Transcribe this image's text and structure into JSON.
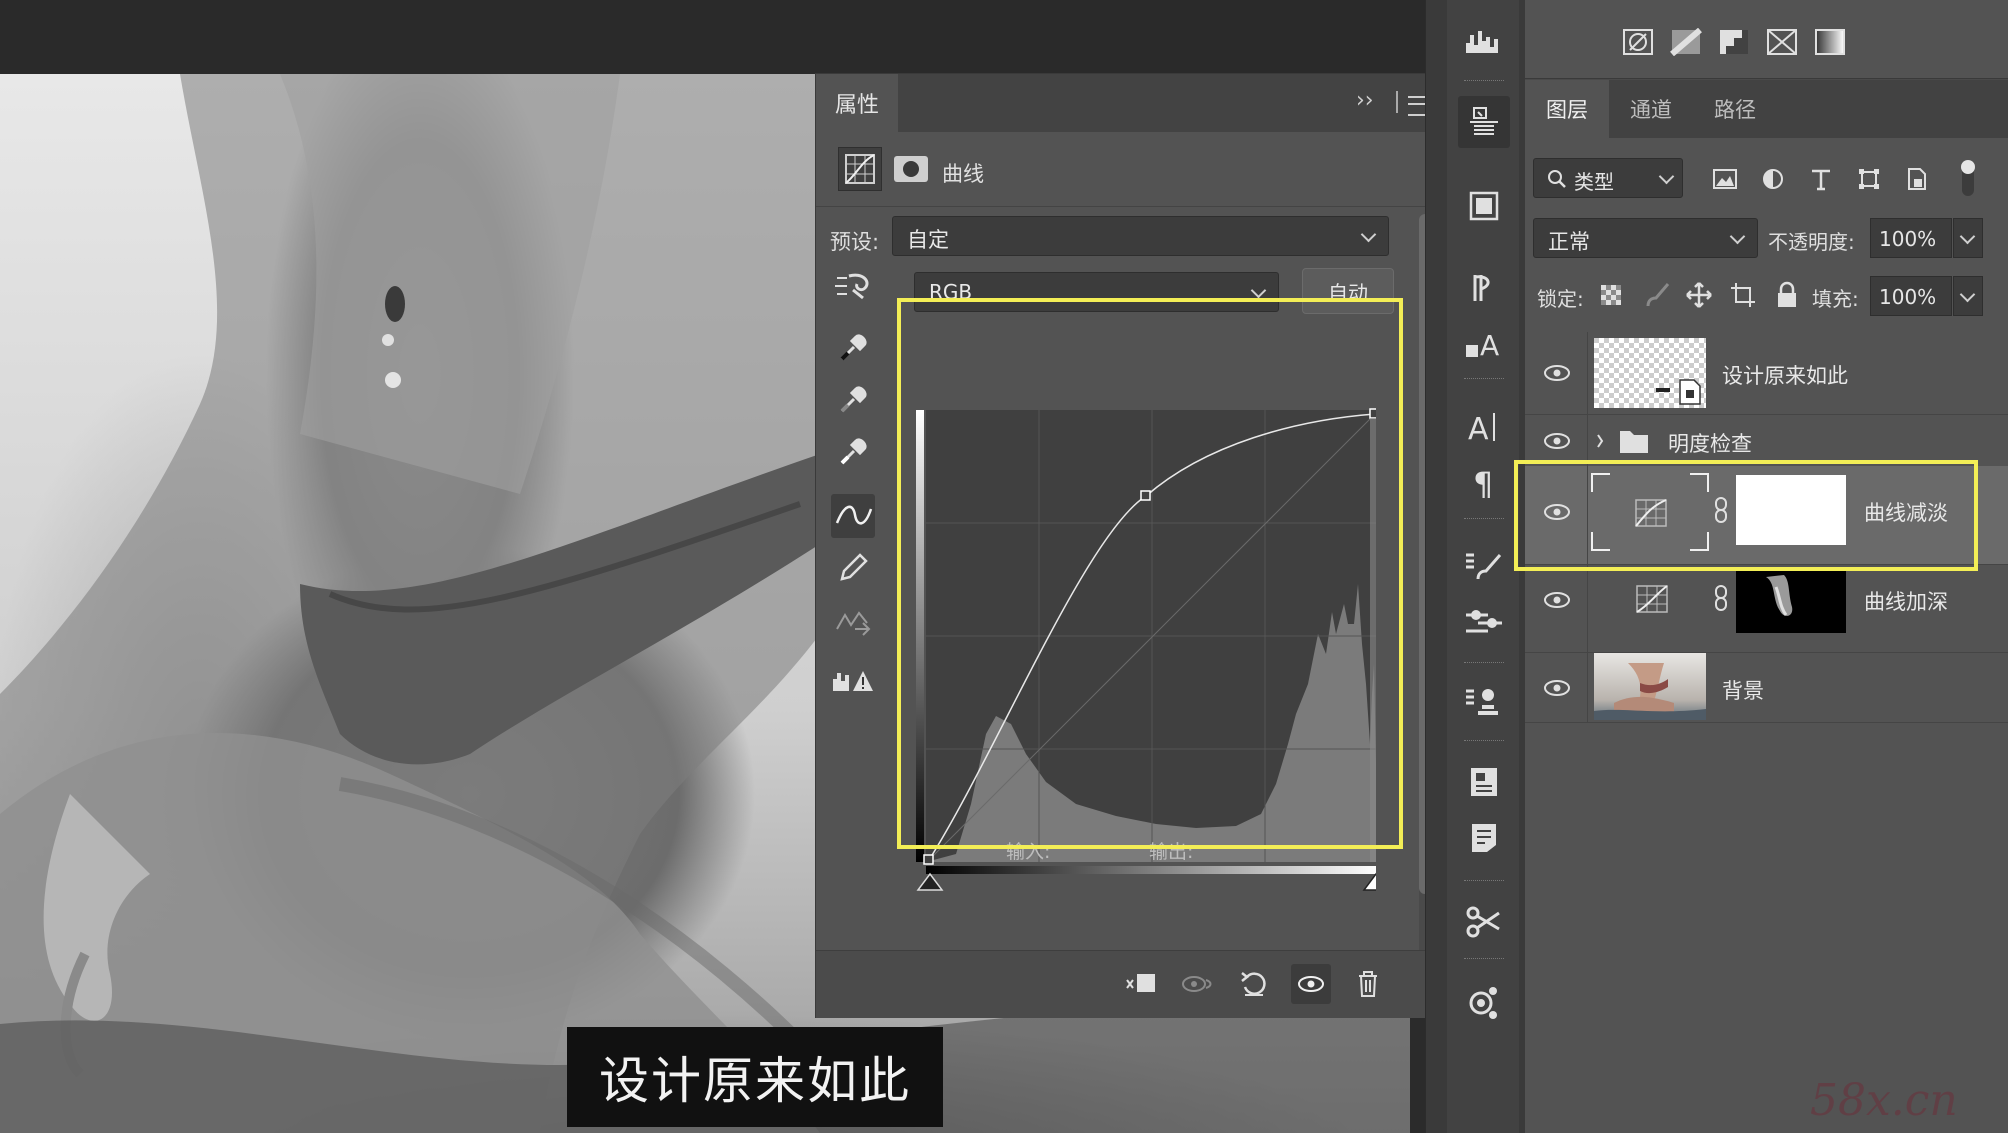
{
  "caption": {
    "text": "设计原来如此"
  },
  "properties": {
    "tab_label": "属性",
    "collapse_glyph": "››",
    "title": "曲线",
    "preset_label": "预设:",
    "preset_value": "自定",
    "channel_value": "RGB",
    "auto_label": "自动",
    "input_label": "输入:",
    "output_label": "输出:",
    "tools": [
      "target-adjust-icon",
      "black-eyedropper-icon",
      "gray-eyedropper-icon",
      "white-eyedropper-icon",
      "curve-point-icon",
      "pencil-icon",
      "smooth-icon",
      "clipping-warning-icon"
    ],
    "footer_buttons": [
      "clip-to-layer-icon",
      "view-previous-icon",
      "reset-icon",
      "visibility-icon",
      "delete-icon"
    ]
  },
  "layers_panel": {
    "tabs": [
      "图层",
      "通道",
      "路径"
    ],
    "filter_value": "类型",
    "blend_mode": "正常",
    "opacity_label": "不透明度:",
    "opacity_value": "100%",
    "lock_label": "锁定:",
    "fill_label": "填充:",
    "fill_value": "100%",
    "layers": [
      {
        "name": "设计原来如此",
        "type": "smart-object",
        "visible": true
      },
      {
        "name": "明度检查",
        "type": "group",
        "visible": true
      },
      {
        "name": "曲线减淡",
        "type": "curves-adjustment",
        "visible": true,
        "selected": true
      },
      {
        "name": "曲线加深",
        "type": "curves-adjustment",
        "visible": true
      },
      {
        "name": "背景",
        "type": "image",
        "visible": true
      }
    ]
  },
  "watermark": "58x.cn",
  "colors": {
    "highlight": "#f3ee56",
    "panel": "#535353",
    "dark": "#3c3c3c"
  }
}
